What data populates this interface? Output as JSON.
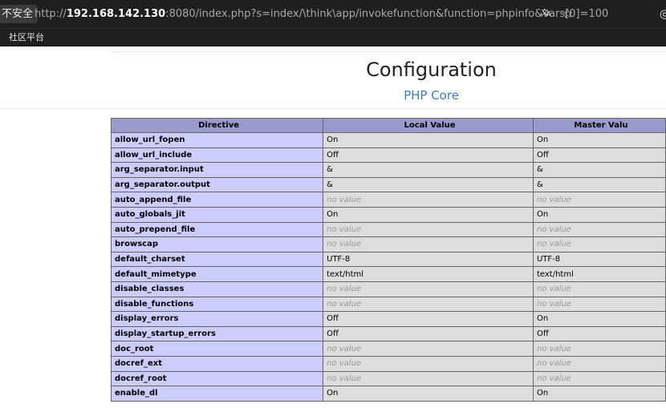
{
  "browser": {
    "security_label": "不安全",
    "url_prefix": "http://",
    "url_host": "192.168.142.130",
    "url_rest": ":8080/index.php?s=index/\\think\\app/invokefunction&function=phpinfo&vars[0]=100",
    "translate_icon": "translate-icon",
    "star_icon": "star-icon",
    "bookmark_label": "社区平台"
  },
  "page": {
    "title": "Configuration",
    "section": "PHP Core"
  },
  "table": {
    "headers": [
      "Directive",
      "Local Value",
      "Master Valu"
    ],
    "rows": [
      {
        "directive": "allow_url_fopen",
        "local": "On",
        "master": "On"
      },
      {
        "directive": "allow_url_include",
        "local": "Off",
        "master": "Off"
      },
      {
        "directive": "arg_separator.input",
        "local": "&",
        "master": "&"
      },
      {
        "directive": "arg_separator.output",
        "local": "&",
        "master": "&"
      },
      {
        "directive": "auto_append_file",
        "local": "no value",
        "master": "no value"
      },
      {
        "directive": "auto_globals_jit",
        "local": "On",
        "master": "On"
      },
      {
        "directive": "auto_prepend_file",
        "local": "no value",
        "master": "no value"
      },
      {
        "directive": "browscap",
        "local": "no value",
        "master": "no value"
      },
      {
        "directive": "default_charset",
        "local": "UTF-8",
        "master": "UTF-8"
      },
      {
        "directive": "default_mimetype",
        "local": "text/html",
        "master": "text/html"
      },
      {
        "directive": "disable_classes",
        "local": "no value",
        "master": "no value"
      },
      {
        "directive": "disable_functions",
        "local": "no value",
        "master": "no value"
      },
      {
        "directive": "display_errors",
        "local": "Off",
        "master": "On"
      },
      {
        "directive": "display_startup_errors",
        "local": "Off",
        "master": "Off"
      },
      {
        "directive": "doc_root",
        "local": "no value",
        "master": "no value"
      },
      {
        "directive": "docref_ext",
        "local": "no value",
        "master": "no value"
      },
      {
        "directive": "docref_root",
        "local": "no value",
        "master": "no value"
      },
      {
        "directive": "enable_dl",
        "local": "On",
        "master": "On"
      }
    ]
  },
  "colors": {
    "header_bg": "#9999cc",
    "directive_bg": "#ccccff",
    "value_bg": "#dddddd",
    "section_link": "#3a7fc1"
  }
}
